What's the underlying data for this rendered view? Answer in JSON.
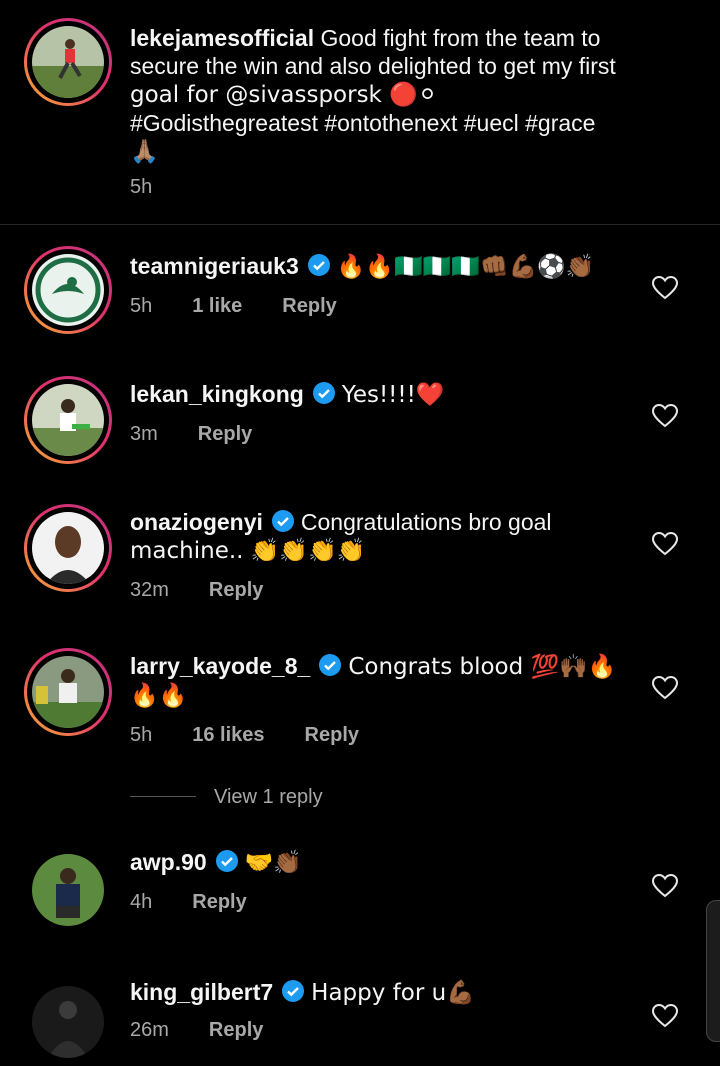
{
  "caption": {
    "username": "lekejamesofficial",
    "text": "Good fight from the team to secure the win and also delighted to get my first goal for @sivassporsk 🔴⚪ #Godisthegreatest #ontothenext #uecl #grace 🙏🏽",
    "lines": [
      "Good fight from the team to",
      "secure the win and also delighted to get my first",
      "goal for @sivassporsk 🔴⚪",
      "#Godisthegreatest #ontothenext #uecl #grace",
      "🙏🏽"
    ],
    "time": "5h"
  },
  "comments": [
    {
      "username": "teamnigeriauk3",
      "verified": true,
      "lines": [
        "🔥🔥🇳🇬🇳🇬🇳🇬👊🏾💪🏾⚽👏🏾"
      ],
      "time": "5h",
      "likes": "1 like",
      "reply": "Reply"
    },
    {
      "username": "lekan_kingkong",
      "verified": true,
      "lines": [
        "Yes!!!!❤️"
      ],
      "time": "3m",
      "likes": "",
      "reply": "Reply"
    },
    {
      "username": "onaziogenyi",
      "verified": true,
      "lines": [
        "Congratulations bro goal",
        "machine.. 👏👏👏👏"
      ],
      "time": "32m",
      "likes": "",
      "reply": "Reply"
    },
    {
      "username": "larry_kayode_8_",
      "verified": true,
      "lines": [
        "Congrats blood 💯🙌🏾🔥",
        "🔥🔥"
      ],
      "time": "5h",
      "likes": "16 likes",
      "reply": "Reply"
    },
    {
      "username": "awp.90",
      "verified": true,
      "lines": [
        "🤝👏🏾"
      ],
      "time": "4h",
      "likes": "",
      "reply": "Reply"
    },
    {
      "username": "king_gilbert7",
      "verified": true,
      "lines": [
        "Happy for u💪🏾"
      ],
      "time": "26m",
      "likes": "",
      "reply": "Reply"
    }
  ],
  "view_replies": "View 1 reply",
  "colors": {
    "background": "#000000",
    "verified": "#1d9bf0",
    "heart_red": "#e0245e"
  }
}
